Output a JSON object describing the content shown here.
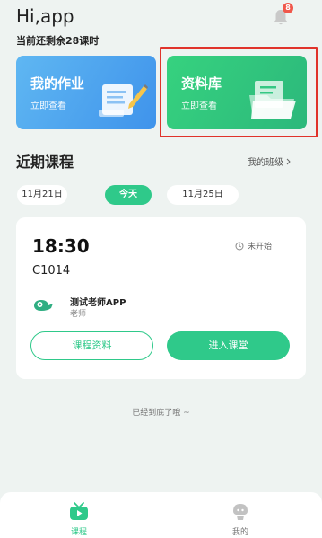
{
  "header": {
    "greeting": "Hi,app",
    "remaining": "当前还剩余28课时",
    "notification_count": "8"
  },
  "cards": {
    "homework": {
      "title": "我的作业",
      "sub": "立即查看"
    },
    "library": {
      "title": "资料库",
      "sub": "立即查看"
    }
  },
  "recent": {
    "title": "近期课程",
    "my_class": "我的班级"
  },
  "dates": {
    "prev": "11月21日",
    "today": "今天",
    "next": "11月25日"
  },
  "lesson": {
    "time": "18:30",
    "status": "未开始",
    "code": "C1014",
    "teacher_name": "测试老师APP",
    "teacher_role": "老师",
    "btn_material": "课程资料",
    "btn_enter": "进入课堂"
  },
  "end_note": "已经到底了哦 ~",
  "tabs": {
    "lessons": "课程",
    "mine": "我的"
  },
  "colors": {
    "accent": "#2fc98a",
    "homework_card": "#4ea4ef",
    "library_card": "#33c880",
    "highlight": "#e0332b",
    "badge": "#f0574b"
  }
}
